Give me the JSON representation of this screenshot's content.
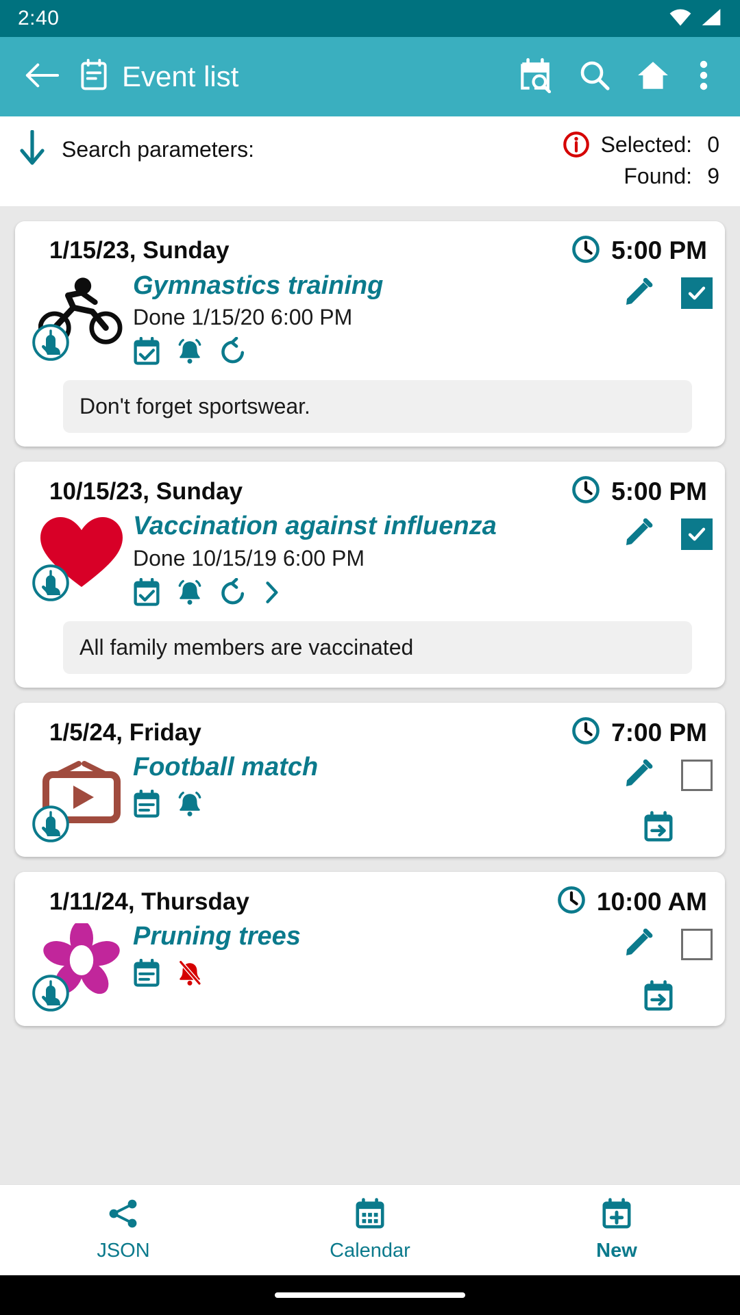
{
  "status_bar": {
    "time": "2:40",
    "icons": [
      "wifi-icon",
      "signal-icon"
    ]
  },
  "app_bar": {
    "back_icon": "back-arrow-icon",
    "title_icon": "event-list-icon",
    "title": "Event list",
    "actions": [
      {
        "name": "calendar-search-icon"
      },
      {
        "name": "search-icon"
      },
      {
        "name": "home-icon"
      },
      {
        "name": "overflow-menu-icon"
      }
    ]
  },
  "search_params": {
    "arrow_icon": "down-arrow-icon",
    "label": "Search parameters:",
    "info_icon": "info-icon",
    "selected_label": "Selected:",
    "selected_value": "0",
    "found_label": "Found:",
    "found_value": "9"
  },
  "colors": {
    "status_bar": "#00727f",
    "app_bar": "#3aafbf",
    "accent": "#0b7a8c",
    "list_bg": "#e8e8e8",
    "card_bg": "#ffffff",
    "note_bg": "#f0f0f0",
    "alert_red": "#d50000",
    "heart_red": "#d80027",
    "flower_magenta": "#c1269b",
    "tv_brown": "#a04b3e"
  },
  "events": [
    {
      "date": "1/15/23, Sunday",
      "time": "5:00 PM",
      "clock_icon": "clock-icon",
      "thumb_icon": "bicycle-icon",
      "touch_icon": "touch-badge-icon",
      "title": "Gymnastics training",
      "subtitle": "Done 1/15/20 6:00 PM",
      "status_icons": [
        "calendar-check-icon",
        "alarm-bell-icon",
        "repeat-icon"
      ],
      "edit_icon": "edit-pencil-icon",
      "checkbox": "checked",
      "note": "Don't forget sportswear.",
      "has_export": false
    },
    {
      "date": "10/15/23, Sunday",
      "time": "5:00 PM",
      "clock_icon": "clock-icon",
      "thumb_icon": "heart-icon",
      "touch_icon": "touch-badge-icon",
      "title": "Vaccination against influenza",
      "subtitle": "Done 10/15/19 6:00 PM",
      "status_icons": [
        "calendar-check-icon",
        "alarm-bell-icon",
        "repeat-icon",
        "chevron-right-icon"
      ],
      "edit_icon": "edit-pencil-icon",
      "checkbox": "checked",
      "note": "All family members are vaccinated",
      "has_export": false
    },
    {
      "date": "1/5/24, Friday",
      "time": "7:00 PM",
      "clock_icon": "clock-icon",
      "thumb_icon": "tv-icon",
      "touch_icon": "touch-badge-icon",
      "title": "Football match",
      "subtitle": "",
      "status_icons": [
        "calendar-icon",
        "alarm-bell-icon"
      ],
      "edit_icon": "edit-pencil-icon",
      "checkbox": "unchecked",
      "note": "",
      "has_export": true,
      "export_icon": "calendar-export-icon"
    },
    {
      "date": "1/11/24, Thursday",
      "time": "10:00 AM",
      "clock_icon": "clock-icon",
      "thumb_icon": "flower-icon",
      "touch_icon": "touch-badge-icon",
      "title": "Pruning trees",
      "subtitle": "",
      "status_icons": [
        "calendar-icon",
        "alarm-bell-off-icon"
      ],
      "edit_icon": "edit-pencil-icon",
      "checkbox": "unchecked",
      "note": "",
      "has_export": true,
      "export_icon": "calendar-export-icon"
    }
  ],
  "bottom_nav": [
    {
      "icon": "share-icon",
      "label": "JSON",
      "selected": false
    },
    {
      "icon": "calendar-month-icon",
      "label": "Calendar",
      "selected": false
    },
    {
      "icon": "add-event-icon",
      "label": "New",
      "selected": true
    }
  ]
}
